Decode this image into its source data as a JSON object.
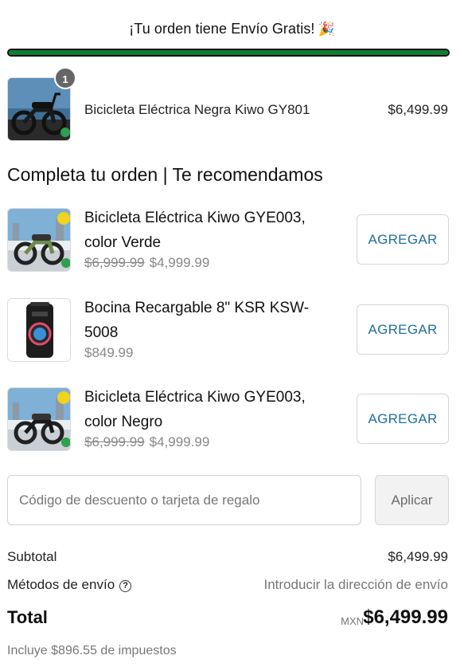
{
  "banner": {
    "text": "¡Tu orden tiene Envío Gratis!",
    "emoji": "🎉",
    "progress": 1.0,
    "progress_color": "#0e7c32"
  },
  "cart": {
    "items": [
      {
        "name": "Bicicleta Eléctrica Negra Kiwo GY801",
        "price": "$6,499.99",
        "quantity": "1",
        "thumb_icon": "electric-bike-black-icon"
      }
    ]
  },
  "recommendations": {
    "heading": "Completa tu orden | Te recomendamos",
    "button_label": "AGREGAR",
    "items": [
      {
        "title": "Bicicleta Eléctrica Kiwo GYE003, color Verde",
        "old_price": "$6,999.99",
        "price": "$4,999.99",
        "thumb_icon": "electric-bike-green-icon"
      },
      {
        "title": "Bocina Recargable 8\" KSR KSW-5008",
        "old_price": "",
        "price": "$849.99",
        "thumb_icon": "speaker-icon"
      },
      {
        "title": "Bicicleta Eléctrica Kiwo GYE003, color Negro",
        "old_price": "$6,999.99",
        "price": "$4,999.99",
        "thumb_icon": "electric-bike-black-icon"
      }
    ]
  },
  "discount": {
    "placeholder": "Código de descuento o tarjeta de regalo",
    "value": "",
    "apply_label": "Aplicar"
  },
  "summary": {
    "subtotal_label": "Subtotal",
    "subtotal_value": "$6,499.99",
    "shipping_label": "Métodos de envío",
    "shipping_help_icon": "question-circle-icon",
    "shipping_value": "Introducir la dirección de envío",
    "total_label": "Total",
    "currency": "MXN",
    "total_value": "$6,499.99",
    "taxes_note": "Incluye $896.55 de impuestos"
  },
  "colors": {
    "accent_link": "#1f6f9f",
    "progress": "#0e7c32"
  }
}
